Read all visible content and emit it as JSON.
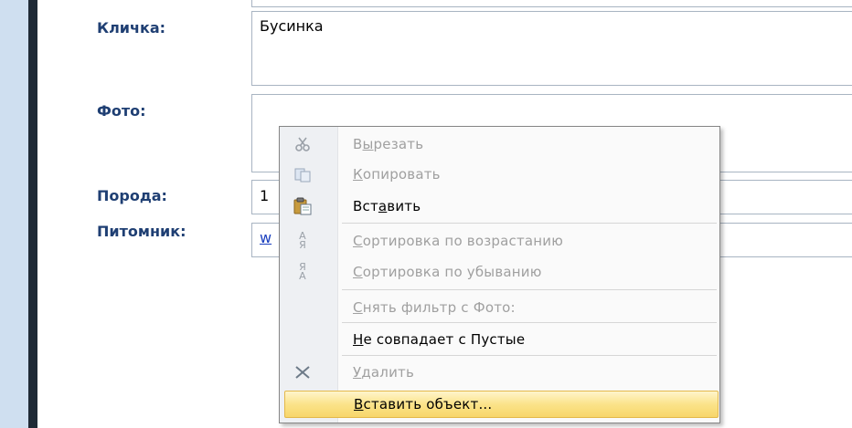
{
  "form": {
    "labels": {
      "nickname": "Кличка:",
      "photo": "Фото:",
      "breed": "Порода:",
      "kennel": "Питомник:"
    },
    "values": {
      "nickname": "Бусинка",
      "breed": "1",
      "kennel": "w"
    }
  },
  "context_menu": {
    "items": [
      {
        "icon": "scissors-icon",
        "label_pre": "В",
        "label_u": "ы",
        "label_post": "резать",
        "enabled": false
      },
      {
        "icon": "copy-icon",
        "label_pre": "",
        "label_u": "К",
        "label_post": "опировать",
        "enabled": false
      },
      {
        "icon": "paste-icon",
        "label_pre": "Вст",
        "label_u": "а",
        "label_post": "вить",
        "enabled": true
      },
      {
        "icon": "sort-ascending-icon",
        "label_pre": "",
        "label_u": "С",
        "label_post": "ортировка по возрастанию",
        "enabled": false
      },
      {
        "icon": "sort-descending-icon",
        "label_pre": "",
        "label_u": "С",
        "label_post": "ортировка по убыванию",
        "enabled": false
      },
      {
        "icon": "",
        "label_pre": "",
        "label_u": "С",
        "label_post": "нять фильтр с Фото:",
        "enabled": false
      },
      {
        "icon": "",
        "label_pre": "",
        "label_u": "Н",
        "label_post": "е совпадает с Пустые",
        "enabled": true
      },
      {
        "icon": "delete-icon",
        "label_pre": "",
        "label_u": "У",
        "label_post": "далить",
        "enabled": false
      },
      {
        "icon": "",
        "label_pre": "",
        "label_u": "В",
        "label_post": "ставить объект...",
        "enabled": true,
        "highlighted": true
      }
    ]
  }
}
